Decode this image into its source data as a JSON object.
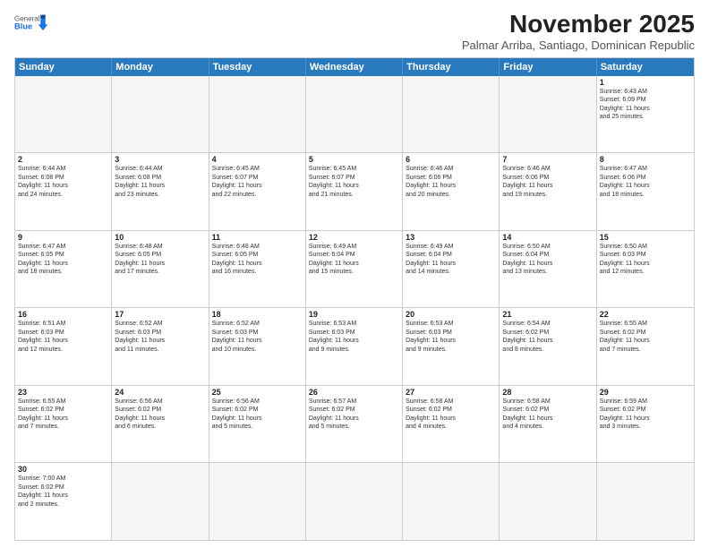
{
  "header": {
    "logo_general": "General",
    "logo_blue": "Blue",
    "month": "November 2025",
    "location": "Palmar Arriba, Santiago, Dominican Republic"
  },
  "days_of_week": [
    "Sunday",
    "Monday",
    "Tuesday",
    "Wednesday",
    "Thursday",
    "Friday",
    "Saturday"
  ],
  "weeks": [
    [
      {
        "day": "",
        "info": ""
      },
      {
        "day": "",
        "info": ""
      },
      {
        "day": "",
        "info": ""
      },
      {
        "day": "",
        "info": ""
      },
      {
        "day": "",
        "info": ""
      },
      {
        "day": "",
        "info": ""
      },
      {
        "day": "1",
        "info": "Sunrise: 6:43 AM\nSunset: 6:09 PM\nDaylight: 11 hours\nand 25 minutes."
      }
    ],
    [
      {
        "day": "2",
        "info": "Sunrise: 6:44 AM\nSunset: 6:08 PM\nDaylight: 11 hours\nand 24 minutes."
      },
      {
        "day": "3",
        "info": "Sunrise: 6:44 AM\nSunset: 6:08 PM\nDaylight: 11 hours\nand 23 minutes."
      },
      {
        "day": "4",
        "info": "Sunrise: 6:45 AM\nSunset: 6:07 PM\nDaylight: 11 hours\nand 22 minutes."
      },
      {
        "day": "5",
        "info": "Sunrise: 6:45 AM\nSunset: 6:07 PM\nDaylight: 11 hours\nand 21 minutes."
      },
      {
        "day": "6",
        "info": "Sunrise: 6:46 AM\nSunset: 6:06 PM\nDaylight: 11 hours\nand 20 minutes."
      },
      {
        "day": "7",
        "info": "Sunrise: 6:46 AM\nSunset: 6:06 PM\nDaylight: 11 hours\nand 19 minutes."
      },
      {
        "day": "8",
        "info": "Sunrise: 6:47 AM\nSunset: 6:06 PM\nDaylight: 11 hours\nand 18 minutes."
      }
    ],
    [
      {
        "day": "9",
        "info": "Sunrise: 6:47 AM\nSunset: 6:05 PM\nDaylight: 11 hours\nand 18 minutes."
      },
      {
        "day": "10",
        "info": "Sunrise: 6:48 AM\nSunset: 6:05 PM\nDaylight: 11 hours\nand 17 minutes."
      },
      {
        "day": "11",
        "info": "Sunrise: 6:48 AM\nSunset: 6:05 PM\nDaylight: 11 hours\nand 16 minutes."
      },
      {
        "day": "12",
        "info": "Sunrise: 6:49 AM\nSunset: 6:04 PM\nDaylight: 11 hours\nand 15 minutes."
      },
      {
        "day": "13",
        "info": "Sunrise: 6:49 AM\nSunset: 6:04 PM\nDaylight: 11 hours\nand 14 minutes."
      },
      {
        "day": "14",
        "info": "Sunrise: 6:50 AM\nSunset: 6:04 PM\nDaylight: 11 hours\nand 13 minutes."
      },
      {
        "day": "15",
        "info": "Sunrise: 6:50 AM\nSunset: 6:03 PM\nDaylight: 11 hours\nand 12 minutes."
      }
    ],
    [
      {
        "day": "16",
        "info": "Sunrise: 6:51 AM\nSunset: 6:03 PM\nDaylight: 11 hours\nand 12 minutes."
      },
      {
        "day": "17",
        "info": "Sunrise: 6:52 AM\nSunset: 6:03 PM\nDaylight: 11 hours\nand 11 minutes."
      },
      {
        "day": "18",
        "info": "Sunrise: 6:52 AM\nSunset: 6:03 PM\nDaylight: 11 hours\nand 10 minutes."
      },
      {
        "day": "19",
        "info": "Sunrise: 6:53 AM\nSunset: 6:03 PM\nDaylight: 11 hours\nand 9 minutes."
      },
      {
        "day": "20",
        "info": "Sunrise: 6:53 AM\nSunset: 6:03 PM\nDaylight: 11 hours\nand 9 minutes."
      },
      {
        "day": "21",
        "info": "Sunrise: 6:54 AM\nSunset: 6:02 PM\nDaylight: 11 hours\nand 8 minutes."
      },
      {
        "day": "22",
        "info": "Sunrise: 6:55 AM\nSunset: 6:02 PM\nDaylight: 11 hours\nand 7 minutes."
      }
    ],
    [
      {
        "day": "23",
        "info": "Sunrise: 6:55 AM\nSunset: 6:02 PM\nDaylight: 11 hours\nand 7 minutes."
      },
      {
        "day": "24",
        "info": "Sunrise: 6:56 AM\nSunset: 6:02 PM\nDaylight: 11 hours\nand 6 minutes."
      },
      {
        "day": "25",
        "info": "Sunrise: 6:56 AM\nSunset: 6:02 PM\nDaylight: 11 hours\nand 5 minutes."
      },
      {
        "day": "26",
        "info": "Sunrise: 6:57 AM\nSunset: 6:02 PM\nDaylight: 11 hours\nand 5 minutes."
      },
      {
        "day": "27",
        "info": "Sunrise: 6:58 AM\nSunset: 6:02 PM\nDaylight: 11 hours\nand 4 minutes."
      },
      {
        "day": "28",
        "info": "Sunrise: 6:58 AM\nSunset: 6:02 PM\nDaylight: 11 hours\nand 4 minutes."
      },
      {
        "day": "29",
        "info": "Sunrise: 6:59 AM\nSunset: 6:02 PM\nDaylight: 11 hours\nand 3 minutes."
      }
    ],
    [
      {
        "day": "30",
        "info": "Sunrise: 7:00 AM\nSunset: 6:02 PM\nDaylight: 11 hours\nand 2 minutes."
      },
      {
        "day": "",
        "info": ""
      },
      {
        "day": "",
        "info": ""
      },
      {
        "day": "",
        "info": ""
      },
      {
        "day": "",
        "info": ""
      },
      {
        "day": "",
        "info": ""
      },
      {
        "day": "",
        "info": ""
      }
    ]
  ]
}
